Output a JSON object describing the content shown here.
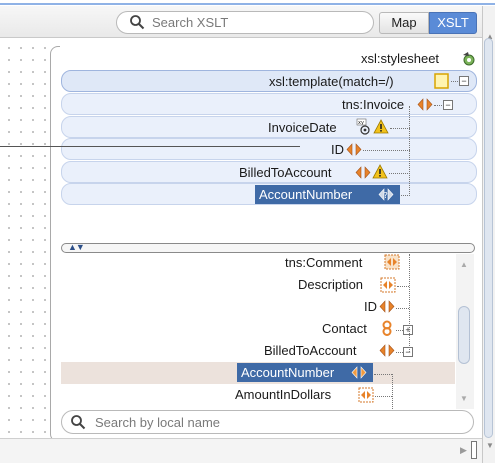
{
  "toolbar": {
    "search_placeholder": "Search XSLT",
    "map_label": "Map",
    "xslt_label": "XSLT"
  },
  "upper_tree": {
    "stylesheet": "xsl:stylesheet",
    "template": "xsl:template(match=/)",
    "invoice": "tns:Invoice",
    "invoice_date": "InvoiceDate",
    "id": "ID",
    "billed_to_account": "BilledToAccount",
    "account_number": "AccountNumber"
  },
  "lower_list": {
    "items": [
      "tns:Comment",
      "Description",
      "ID",
      "Contact",
      "BilledToAccount",
      "AccountNumber",
      "AmountInDollars"
    ]
  },
  "bottom_search": {
    "placeholder": "Search by local name"
  },
  "colors": {
    "accent": "#5a8bd7",
    "selection": "#3f6aa6",
    "band": "#eaf0fb",
    "diamond_orange": "#e8832a",
    "warning_yellow": "#f2c21b"
  }
}
